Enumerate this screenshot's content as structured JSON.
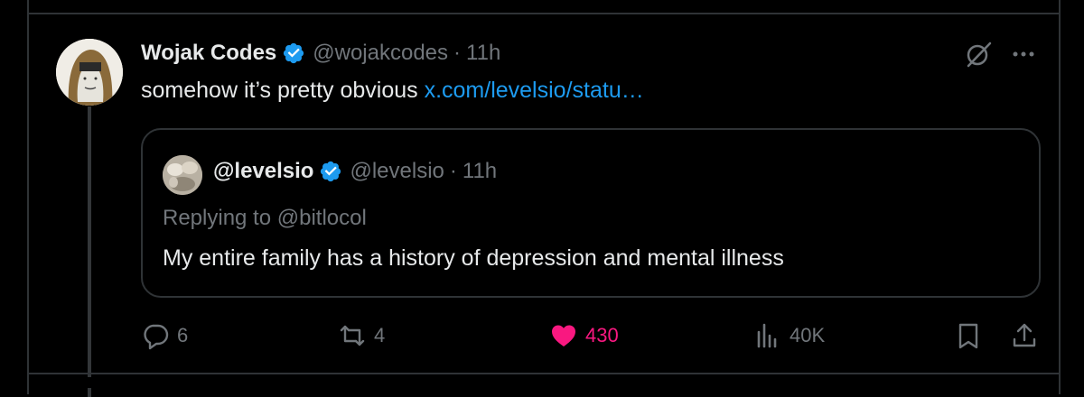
{
  "tweet": {
    "author": {
      "display_name": "Wojak Codes",
      "handle": "@wojakcodes",
      "separator": "·",
      "time": "11h"
    },
    "text": "somehow it’s pretty obvious ",
    "link": "x.com/levelsio/statu…"
  },
  "quote": {
    "author": {
      "display_name": "@levelsio",
      "handle": "@levelsio",
      "separator": "·",
      "time": "11h"
    },
    "replying_to": "Replying to @bitlocol",
    "text": "My entire family has a history of depression and mental illness"
  },
  "actions": {
    "replies": "6",
    "reposts": "4",
    "likes": "430",
    "views": "40K"
  },
  "colors": {
    "background": "#000000",
    "text": "#e7e9ea",
    "muted": "#71767b",
    "link": "#1d9bf0",
    "verified": "#1d9bf0",
    "like": "#f91880",
    "border": "#2f3336"
  },
  "icons": [
    "verified-badge-icon",
    "grok-icon",
    "more-icon",
    "reply-icon",
    "repost-icon",
    "heart-icon",
    "views-icon",
    "bookmark-icon",
    "share-icon"
  ]
}
